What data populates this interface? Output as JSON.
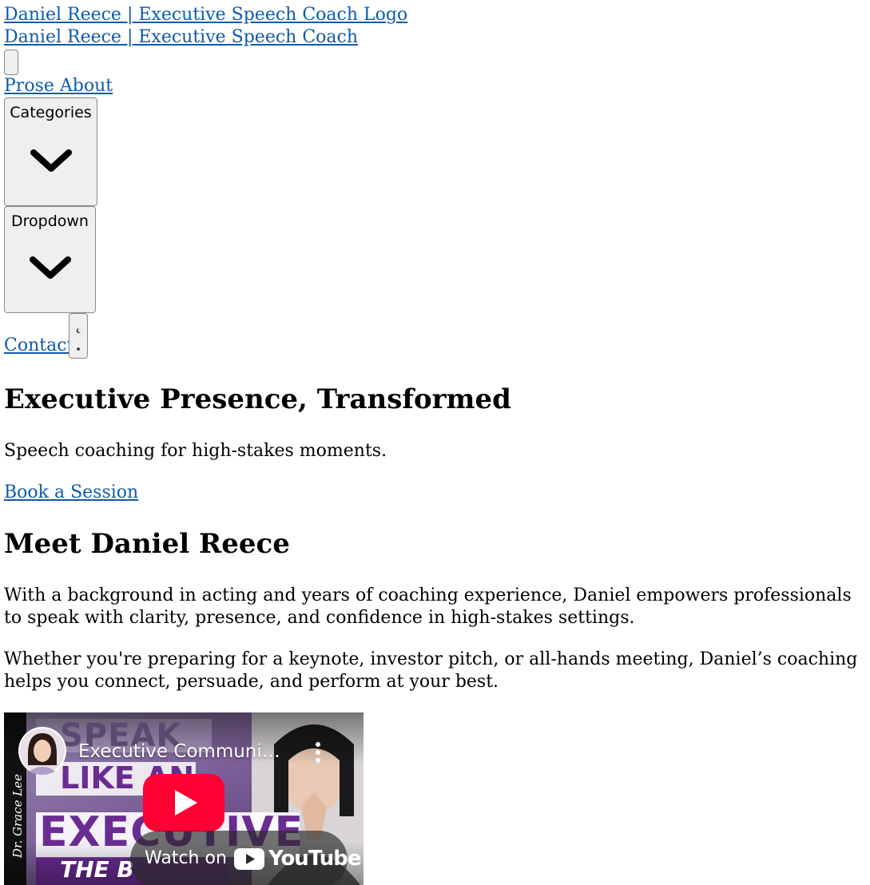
{
  "header": {
    "logo_alt": "Daniel Reece | Executive Speech Coach Logo",
    "site_title": "Daniel Reece | Executive Speech Coach"
  },
  "nav": {
    "prose_about": "Prose About",
    "categories_label": "Categories",
    "dropdown_label": "Dropdown",
    "contact_label": "Contact"
  },
  "hero": {
    "title": "Executive Presence, Transformed",
    "subtitle": "Speech coaching for high-stakes moments.",
    "cta": "Book a Session"
  },
  "about": {
    "heading": "Meet Daniel Reece",
    "para1": "With a background in acting and years of coaching experience, Daniel empowers professionals to speak with clarity, presence, and confidence in high-stakes settings.",
    "para2": "Whether you're preparing for a keynote, investor pitch, or all-hands meeting, Daniel’s coaching helps you connect, persuade, and perform at your best."
  },
  "video": {
    "title": "Executive Communi…",
    "thumb_line1": "SPEAK",
    "thumb_line2": "LIKE AN",
    "thumb_line3": "EXECUTIVE",
    "thumb_line4": "THE B",
    "signature": "Dr. Grace Lee",
    "watch_on": "Watch on",
    "youtube_label": "YouTube",
    "accent_color": "#ff0033"
  }
}
